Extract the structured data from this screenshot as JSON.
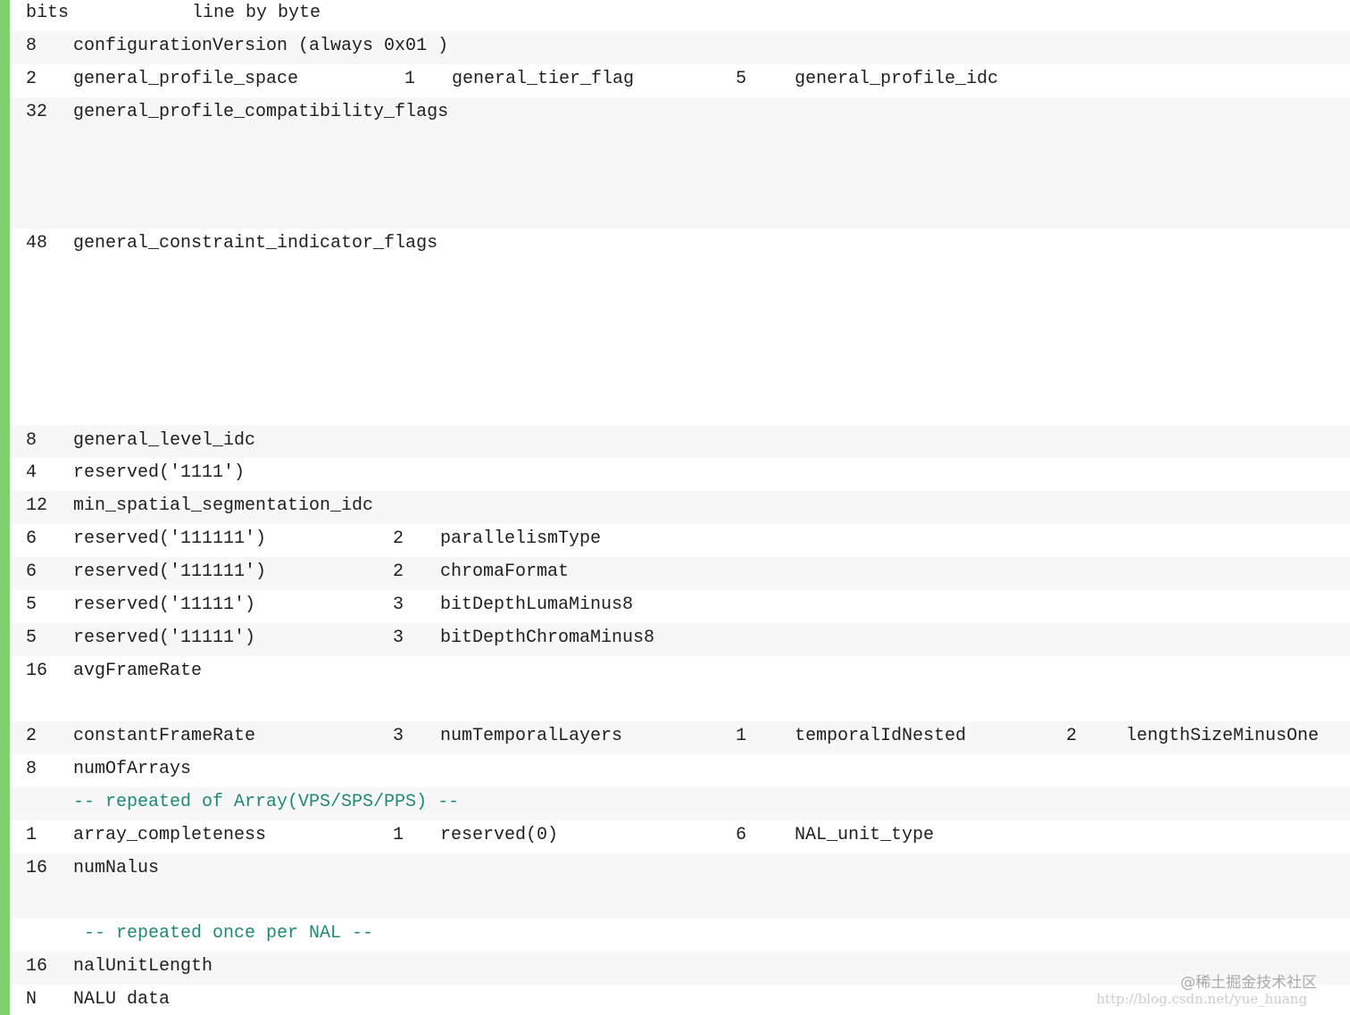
{
  "header": {
    "bits": "bits",
    "title": "line by byte"
  },
  "rows": [
    {
      "cells": [
        "8",
        "configurationVersion (always 0x01 )"
      ]
    },
    {
      "cells": [
        "2",
        "general_profile_space",
        "1",
        "general_tier_flag",
        "5",
        "general_profile_idc"
      ]
    },
    {
      "cells": [
        "32",
        "general_profile_compatibility_flags"
      ]
    },
    {
      "cells": [
        "48",
        "general_constraint_indicator_flags"
      ]
    },
    {
      "cells": [
        "8",
        "general_level_idc"
      ]
    },
    {
      "cells": [
        "4",
        "reserved('1111')"
      ]
    },
    {
      "cells": [
        "12",
        "min_spatial_segmentation_idc"
      ]
    },
    {
      "cells": [
        "6",
        "reserved('111111')",
        "2",
        "parallelismType"
      ]
    },
    {
      "cells": [
        "6",
        "reserved('111111')",
        "2",
        "chromaFormat"
      ]
    },
    {
      "cells": [
        "5",
        "reserved('11111')",
        "3",
        "bitDepthLumaMinus8"
      ]
    },
    {
      "cells": [
        "5",
        "reserved('11111')",
        "3",
        "bitDepthChromaMinus8"
      ]
    },
    {
      "cells": [
        "16",
        "avgFrameRate"
      ]
    },
    {
      "cells": [
        "2",
        "constantFrameRate",
        "3",
        "numTemporalLayers",
        "1",
        "temporalIdNested",
        "2",
        "lengthSizeMinusOne"
      ]
    },
    {
      "cells": [
        "8",
        "numOfArrays"
      ]
    },
    {
      "cells": [
        "",
        "-- repeated of Array(VPS/SPS/PPS) --"
      ]
    },
    {
      "cells": [
        "1",
        "array_completeness",
        "1",
        "reserved(0)",
        "6",
        "NAL_unit_type"
      ]
    },
    {
      "cells": [
        "16",
        "numNalus"
      ]
    },
    {
      "cells": [
        "",
        " -- repeated once per NAL --"
      ]
    },
    {
      "cells": [
        "16",
        "nalUnitLength"
      ]
    },
    {
      "cells": [
        "N",
        "NALU data"
      ]
    }
  ],
  "watermark": {
    "line1": "@稀土掘金技术社区",
    "line2": "http://blog.csdn.net/yue_huang"
  }
}
